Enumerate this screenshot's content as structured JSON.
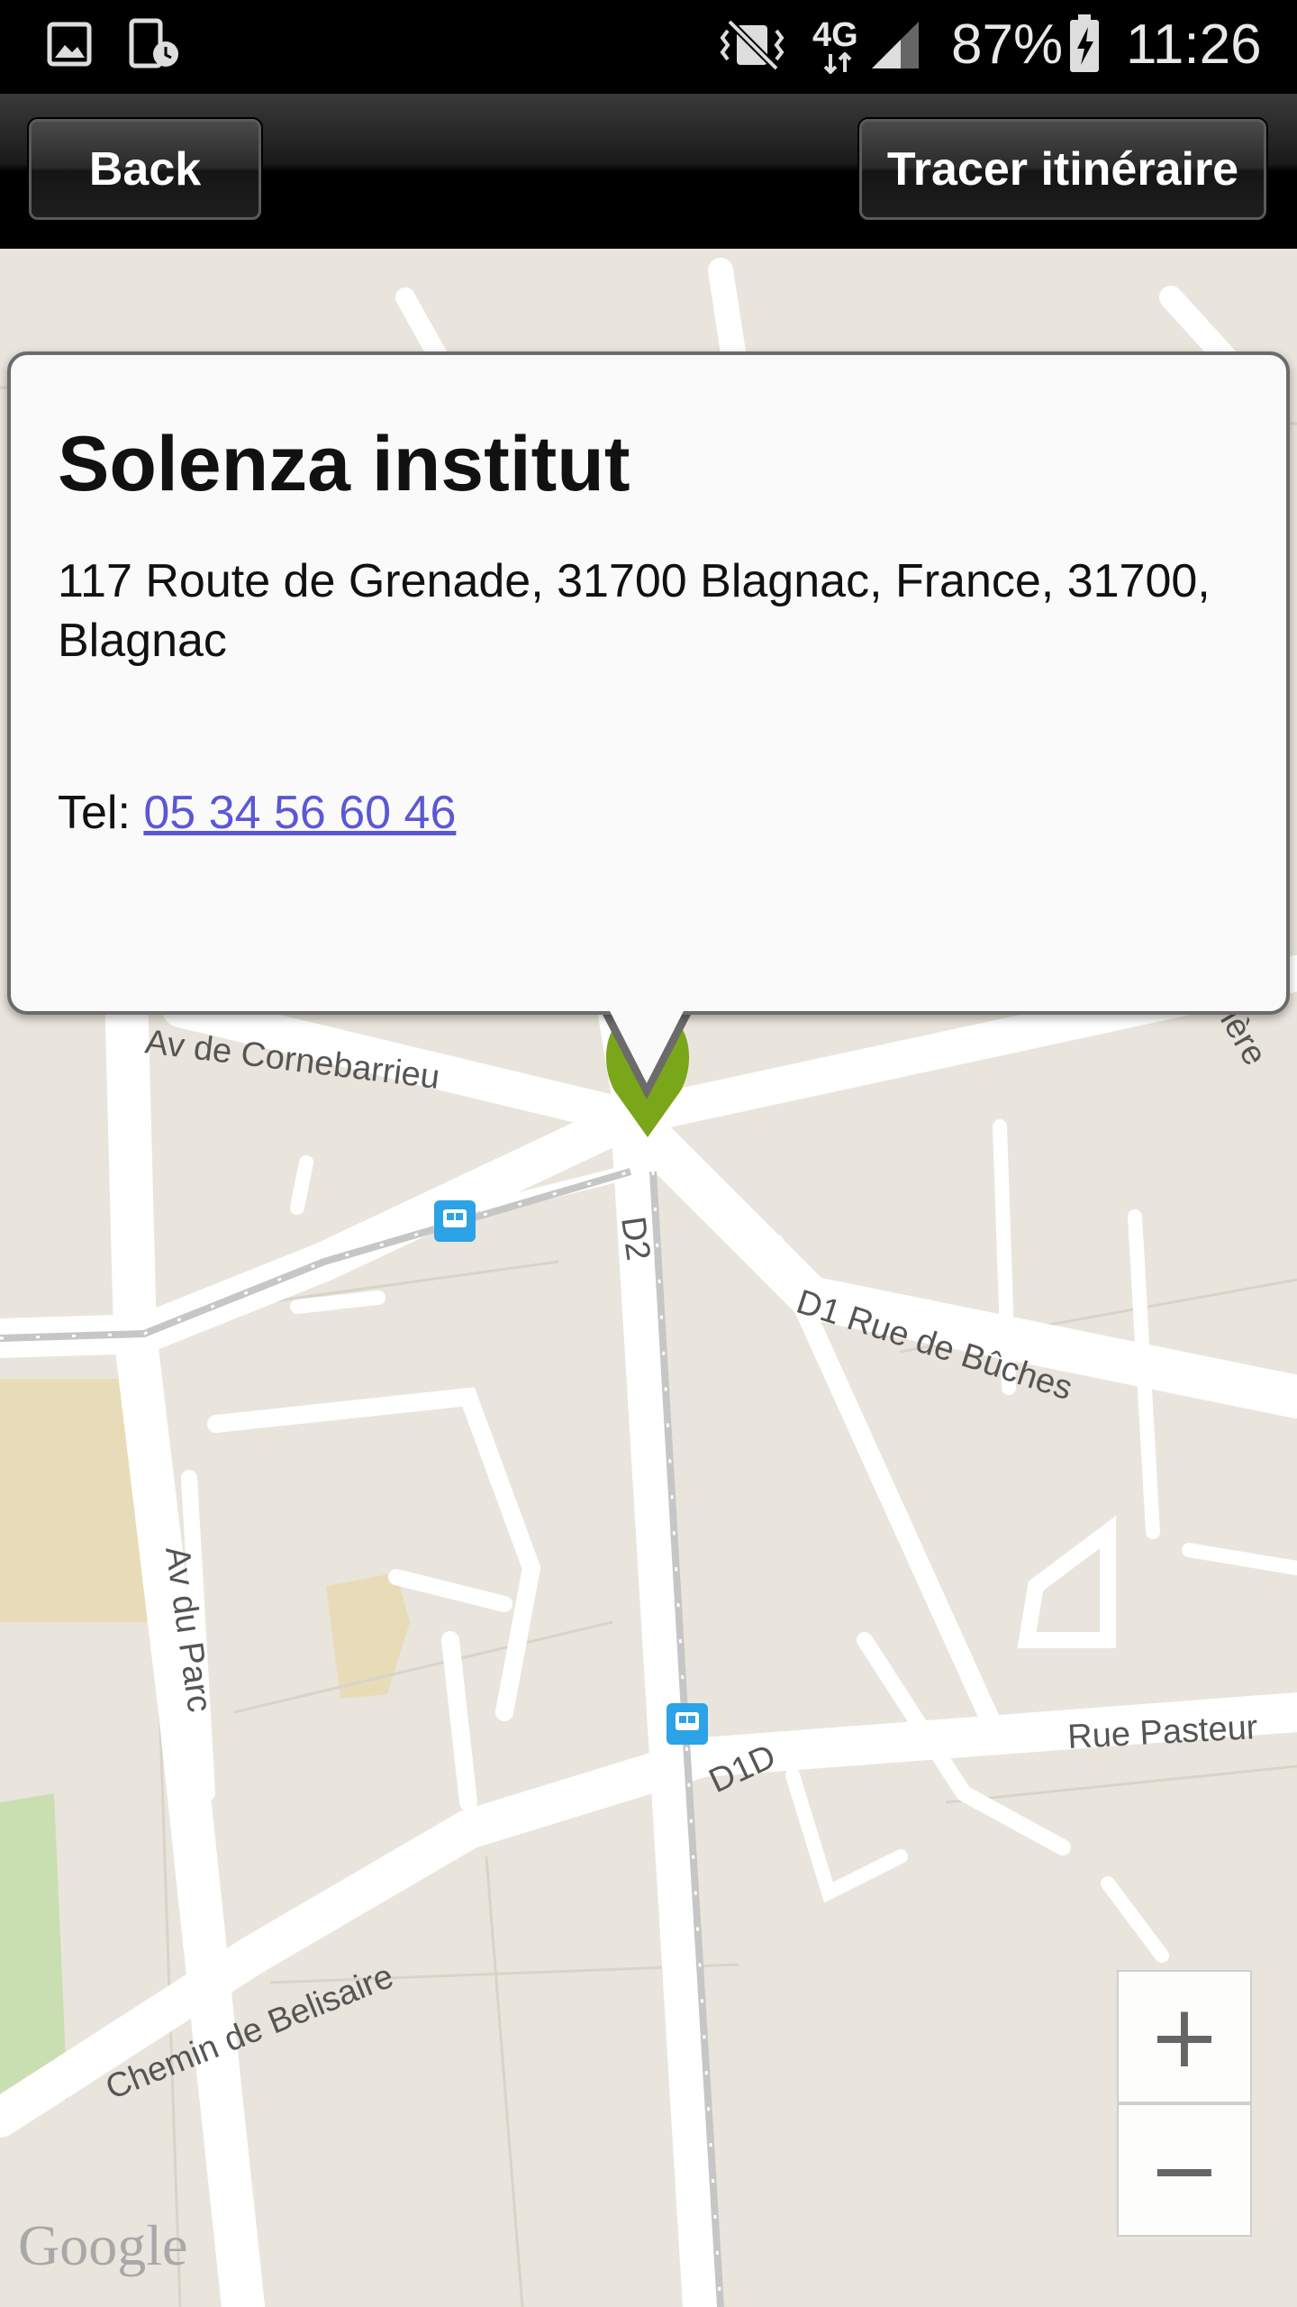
{
  "status_bar": {
    "battery": "87%",
    "time": "11:26",
    "network": "4G"
  },
  "action_bar": {
    "back_label": "Back",
    "route_label": "Tracer itinéraire"
  },
  "popup": {
    "name": "Solenza institut",
    "address": "117 Route de Grenade, 31700 Blagnac, France, 31700, Blagnac",
    "phone_prefix": "Tel: ",
    "phone": "05 34 56 60 46"
  },
  "map": {
    "street_labels": {
      "cornebarrieu": "Av de Cornebarrieu",
      "d2": "D2",
      "d1_buches": "D1  Rue de Bûches",
      "av_parc": "Av du Parc",
      "rue_pasteur": "Rue Pasteur",
      "d1d": "D1D",
      "belisaire": "Chemin de Belisaire",
      "iere": "ière"
    },
    "provider": "Google",
    "zoom_in": "+",
    "zoom_out": "−",
    "marker_color": "#7aa61a"
  }
}
